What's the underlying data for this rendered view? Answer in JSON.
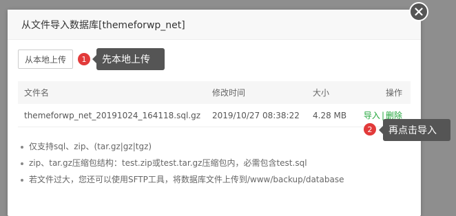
{
  "dialog": {
    "title": "从文件导入数据库[themeforwp_net]",
    "upload_button": "从本地上传",
    "table": {
      "headers": [
        "文件名",
        "修改时间",
        "大小",
        "操作"
      ],
      "rows": [
        {
          "name": "themeforwp_net_20191024_164118.sql.gz",
          "mtime": "2019/10/27 08:38:22",
          "size": "4.28 MB",
          "import": "导入",
          "separator": "|",
          "delete": "删除"
        }
      ]
    },
    "notes": [
      "仅支持sql、zip、(tar.gz|gz|tgz)",
      "zip、tar.gz压缩包结构：test.zip或test.tar.gz压缩包内，必需包含test.sql",
      "若文件过大，您还可以使用SFTP工具，将数据库文件上传到/www/backup/database"
    ]
  },
  "tips": [
    {
      "number": "1",
      "text": "先本地上传"
    },
    {
      "number": "2",
      "text": "再点击导入"
    }
  ],
  "colors": {
    "link": "#20a53a",
    "badge": "#e23a3a",
    "tooltip": "#555555"
  },
  "icons": {
    "close": "close-icon"
  }
}
